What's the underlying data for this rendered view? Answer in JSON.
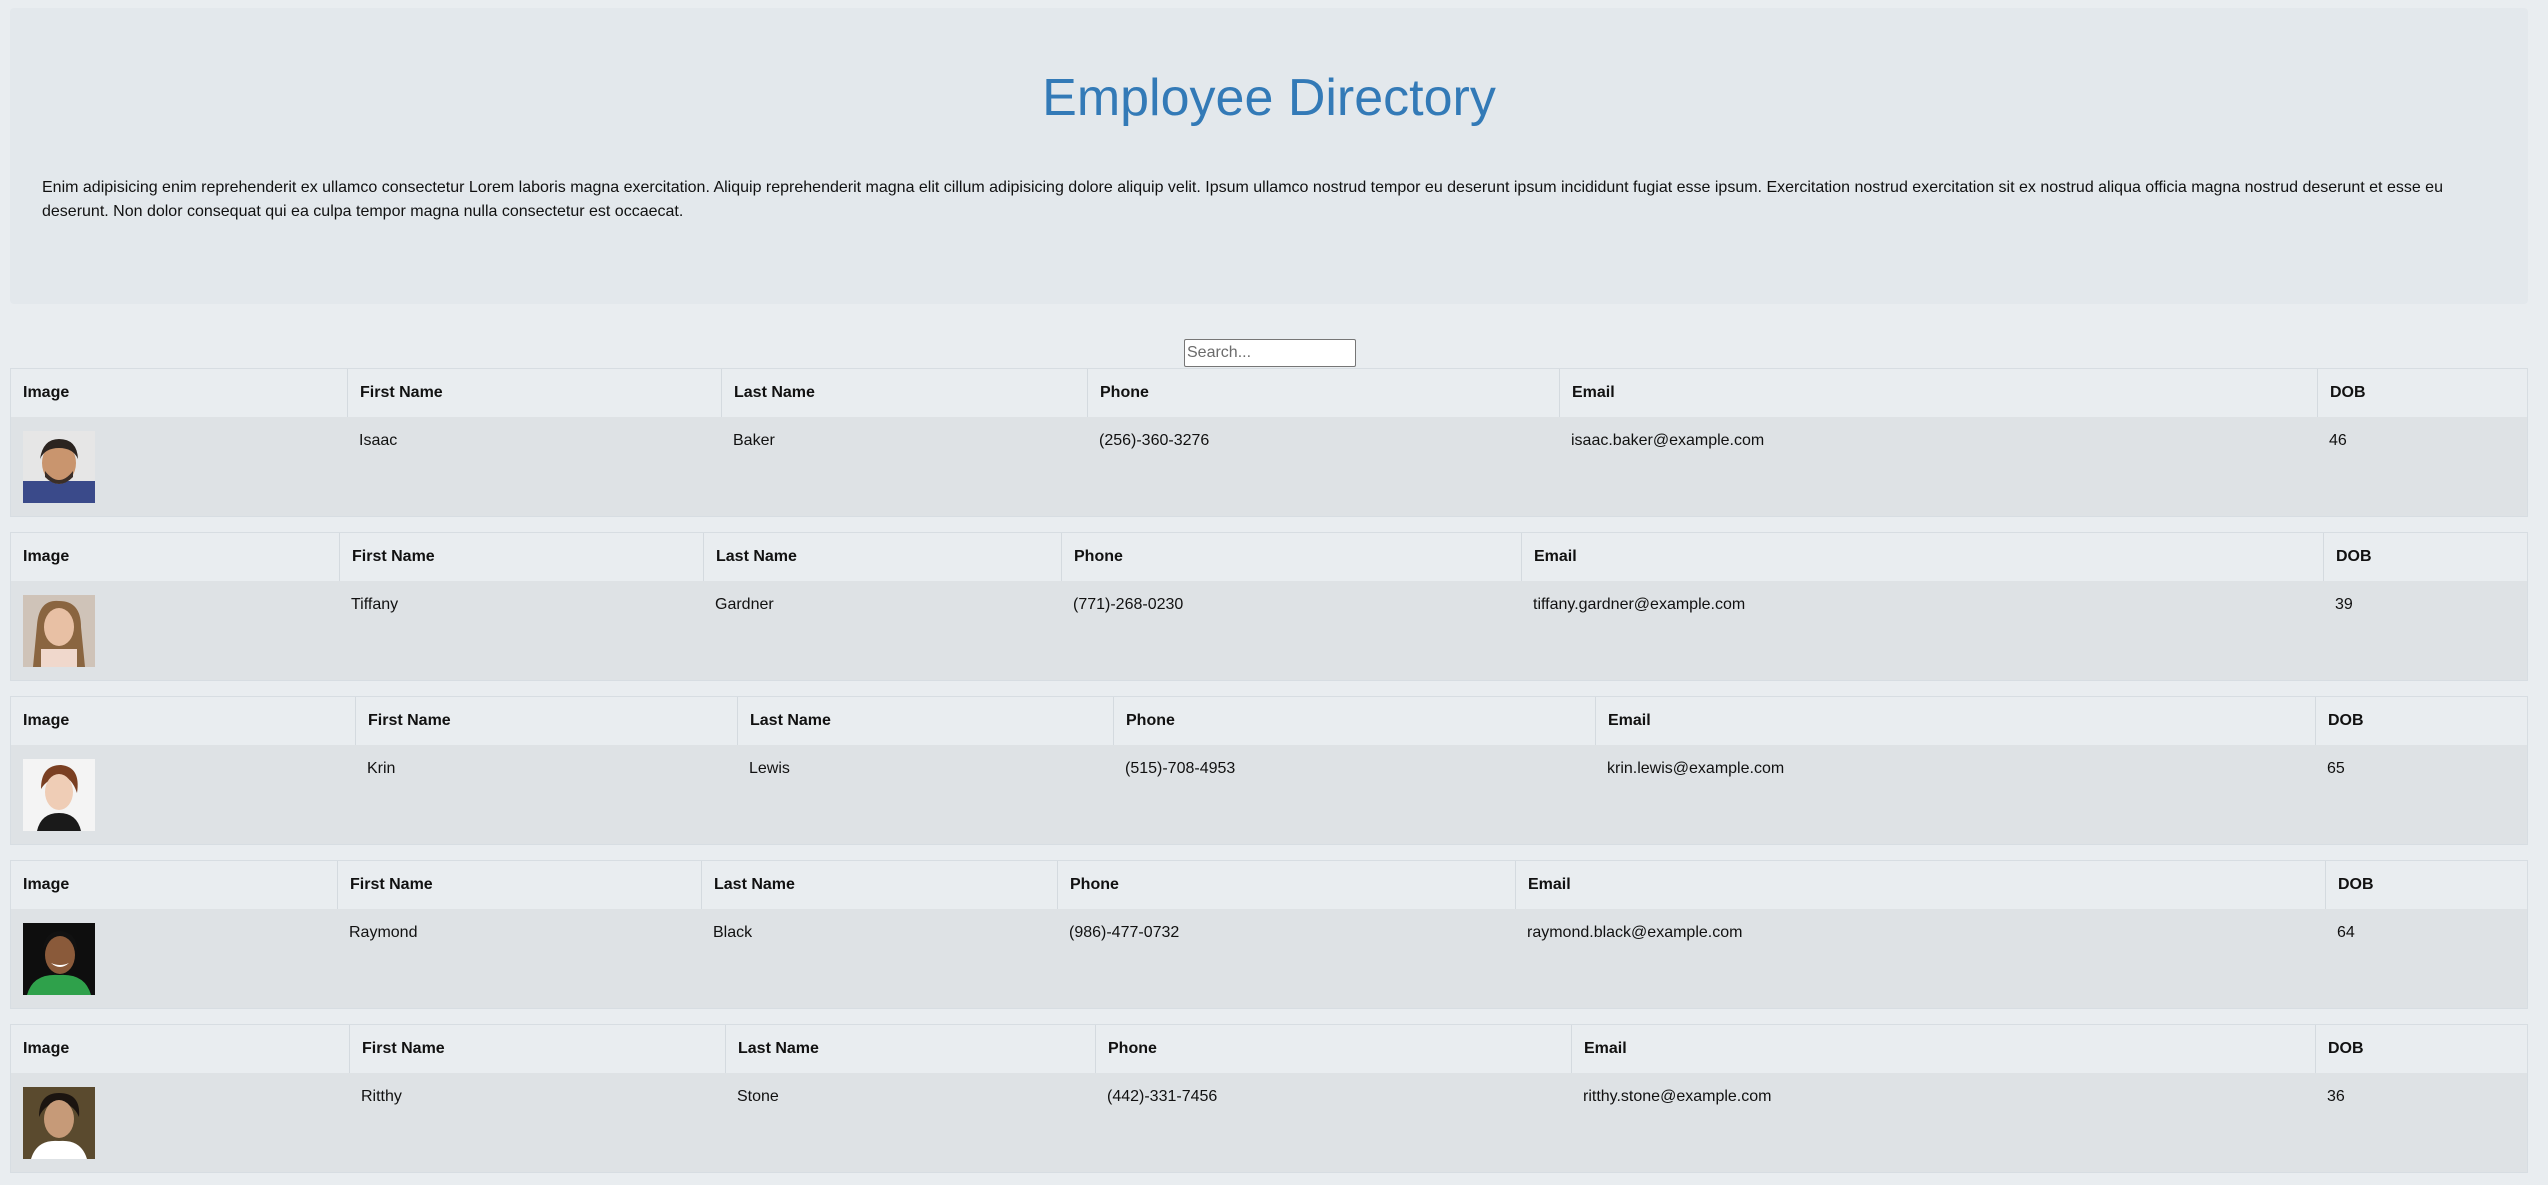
{
  "header": {
    "title": "Employee Directory",
    "description": "Enim adipisicing enim reprehenderit ex ullamco consectetur Lorem laboris magna exercitation. Aliquip reprehenderit magna elit cillum adipisicing dolore aliquip velit. Ipsum ullamco nostrud tempor eu deserunt ipsum incididunt fugiat esse ipsum. Exercitation nostrud exercitation sit ex nostrud aliqua officia magna nostrud deserunt et esse eu deserunt. Non dolor consequat qui ea culpa tempor magna nulla consectetur est occaecat."
  },
  "search": {
    "placeholder": "Search..."
  },
  "columns": [
    "Image",
    "First Name",
    "Last Name",
    "Phone",
    "Email",
    "DOB"
  ],
  "employees": [
    {
      "first": "Isaac",
      "last": "Baker",
      "phone": "(256)-360-3276",
      "email": "isaac.baker@example.com",
      "dob": "46"
    },
    {
      "first": "Tiffany",
      "last": "Gardner",
      "phone": "(771)-268-0230",
      "email": "tiffany.gardner@example.com",
      "dob": "39"
    },
    {
      "first": "Krin",
      "last": "Lewis",
      "phone": "(515)-708-4953",
      "email": "krin.lewis@example.com",
      "dob": "65"
    },
    {
      "first": "Raymond",
      "last": "Black",
      "phone": "(986)-477-0732",
      "email": "raymond.black@example.com",
      "dob": "64"
    },
    {
      "first": "Ritthy",
      "last": "Stone",
      "phone": "(442)-331-7456",
      "email": "ritthy.stone@example.com",
      "dob": "36"
    }
  ]
}
